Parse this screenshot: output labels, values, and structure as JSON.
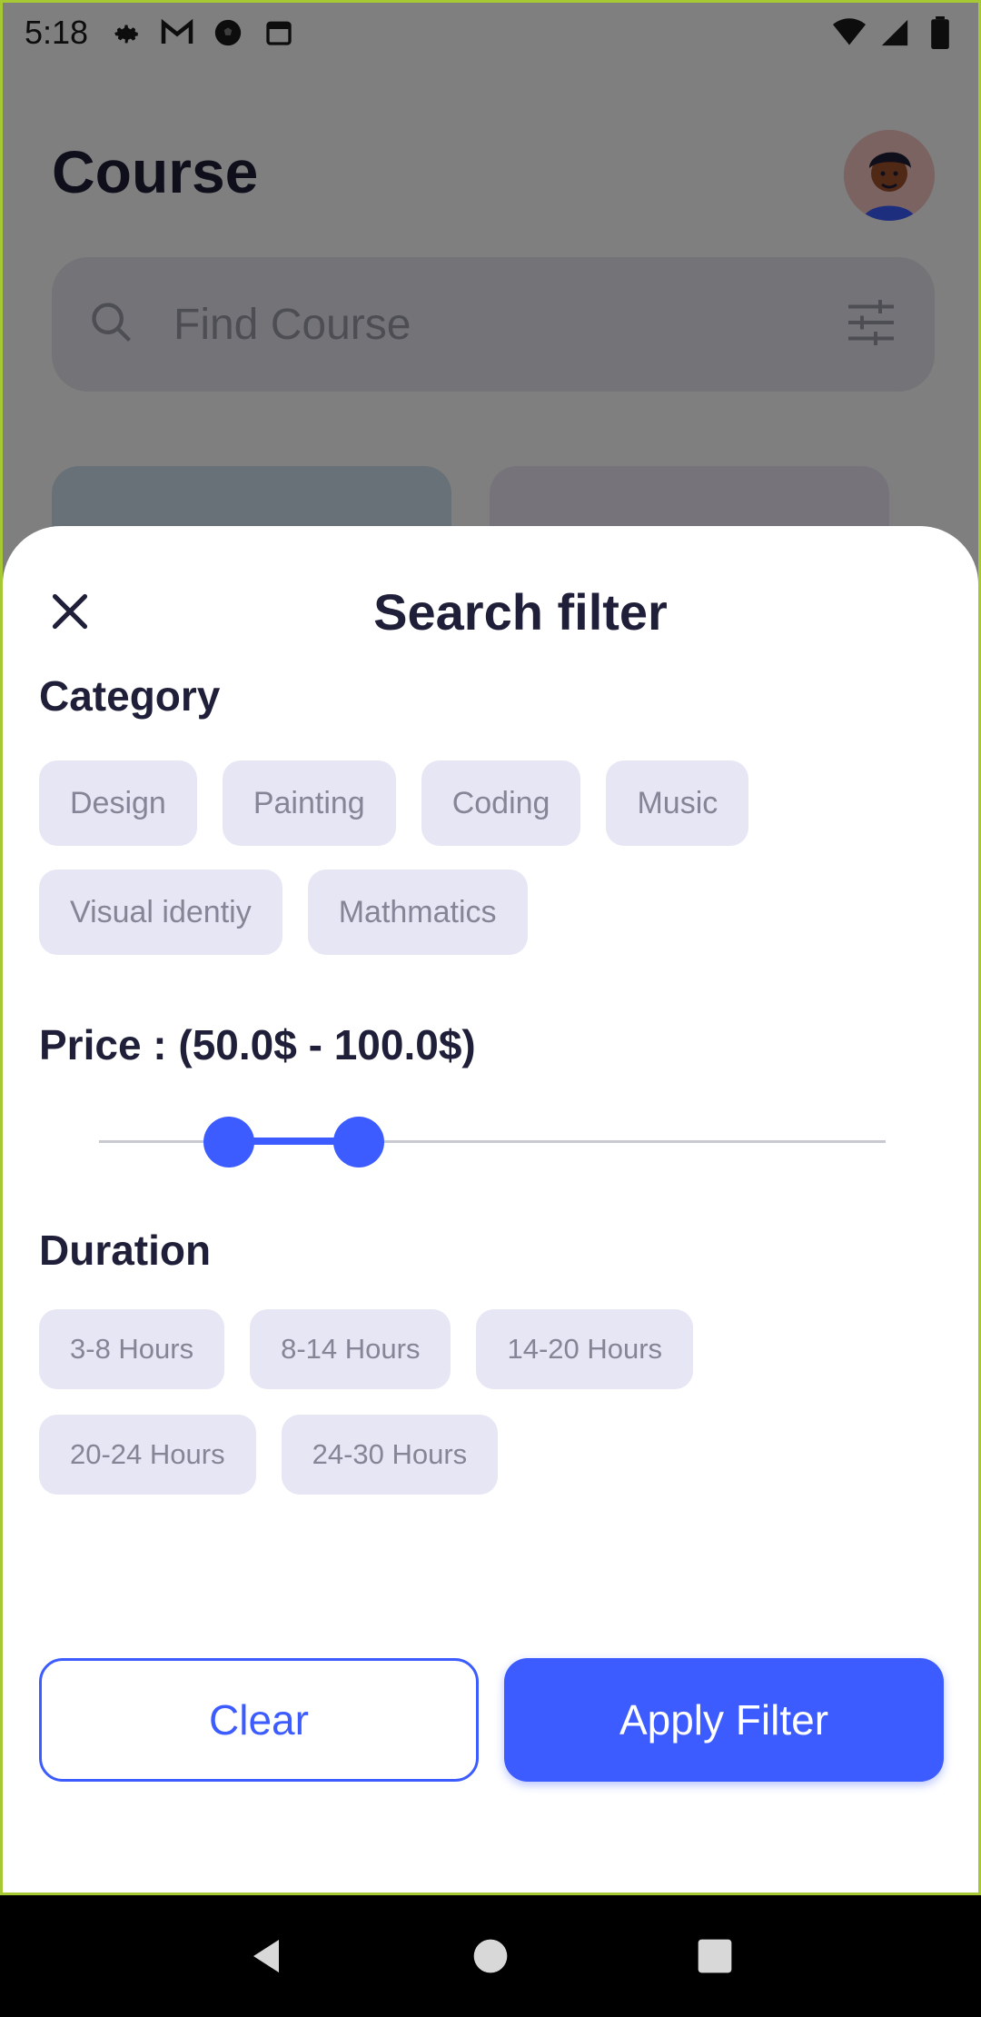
{
  "status_bar": {
    "time": "5:18",
    "left_icons": [
      "settings-icon",
      "gmail-icon",
      "soccer-ball-icon",
      "calendar-icon"
    ],
    "right_icons": [
      "wifi-icon",
      "signal-icon",
      "battery-icon"
    ]
  },
  "background_app": {
    "title": "Course",
    "search_placeholder": "Find Course"
  },
  "sheet": {
    "title": "Search filter",
    "category": {
      "label": "Category",
      "chips": [
        "Design",
        "Painting",
        "Coding",
        "Music",
        "Visual identiy",
        "Mathmatics"
      ]
    },
    "price": {
      "label": "Price : (50.0$ - 100.0$)",
      "range_start_fraction": 0.165,
      "range_end_fraction": 0.33
    },
    "duration": {
      "label": "Duration",
      "chips": [
        "3-8 Hours",
        "8-14 Hours",
        "14-20 Hours",
        "20-24 Hours",
        "24-30 Hours"
      ]
    },
    "buttons": {
      "clear": "Clear",
      "apply": "Apply Filter"
    }
  },
  "colors": {
    "accent": "#3d5cff",
    "chip_bg": "#e7e6f4",
    "chip_text": "#858597",
    "title_text": "#1f1f39"
  },
  "nav_bar": {
    "buttons": [
      "back-icon",
      "home-icon",
      "recents-icon"
    ]
  }
}
